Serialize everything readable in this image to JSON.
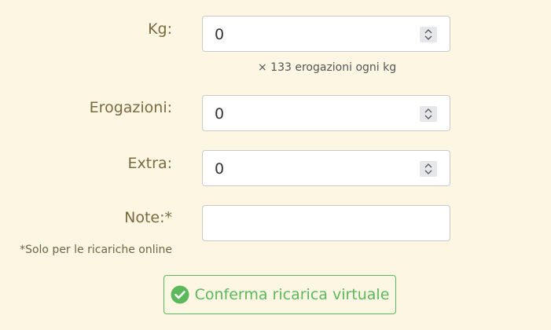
{
  "form": {
    "kg": {
      "label": "Kg:",
      "value": "0",
      "help": "× 133 erogazioni ogni kg"
    },
    "erogazioni": {
      "label": "Erogazioni:",
      "value": "0"
    },
    "extra": {
      "label": "Extra:",
      "value": "0"
    },
    "note": {
      "label": "Note:*",
      "value": "",
      "hint": "*Solo per le ricariche online"
    }
  },
  "confirm": {
    "label": "Conferma ricarica virtuale",
    "icon": "check-circle-icon"
  },
  "colors": {
    "background": "#fcf6e3",
    "label": "#7a6a3f",
    "success": "#5cb85c"
  }
}
